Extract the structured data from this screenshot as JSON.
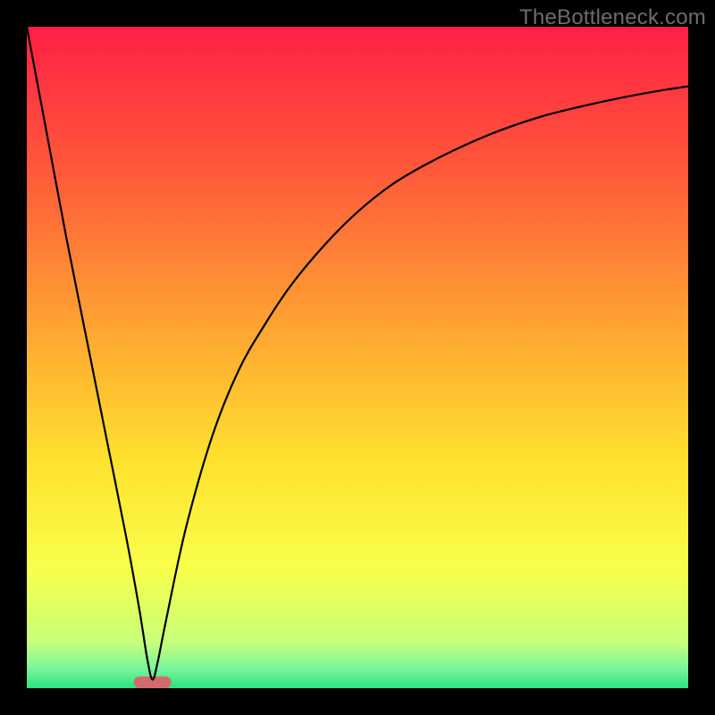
{
  "watermark": "TheBottleneck.com",
  "chart_data": {
    "type": "line",
    "title": "",
    "xlabel": "",
    "ylabel": "",
    "xlim": [
      0,
      100
    ],
    "ylim": [
      0,
      100
    ],
    "grid": false,
    "legend": false,
    "background_gradient": {
      "stops": [
        {
          "offset": 0.0,
          "color": "#ff1f45"
        },
        {
          "offset": 0.22,
          "color": "#ff5a3a"
        },
        {
          "offset": 0.45,
          "color": "#ffa332"
        },
        {
          "offset": 0.66,
          "color": "#ffe22e"
        },
        {
          "offset": 0.82,
          "color": "#f7ff4a"
        },
        {
          "offset": 0.93,
          "color": "#c8ff7a"
        },
        {
          "offset": 0.97,
          "color": "#7af59a"
        },
        {
          "offset": 1.0,
          "color": "#2be37f"
        }
      ]
    },
    "optimum_marker": {
      "x": 19,
      "y": 1.3,
      "color": "#d46a6e"
    },
    "series": [
      {
        "name": "bottleneck-curve",
        "x": [
          0,
          3,
          6,
          9,
          12,
          15,
          17,
          18.2,
          19,
          19.8,
          21,
          24,
          28,
          32,
          36,
          40,
          45,
          50,
          55,
          60,
          66,
          72,
          78,
          84,
          90,
          96,
          100
        ],
        "y": [
          100,
          84,
          68,
          53,
          38,
          23,
          12,
          4.5,
          1.3,
          4.0,
          10,
          24,
          38,
          48,
          55,
          61,
          67,
          72,
          76,
          79,
          82,
          84.5,
          86.5,
          88,
          89.3,
          90.4,
          91
        ]
      }
    ],
    "annotations": []
  }
}
